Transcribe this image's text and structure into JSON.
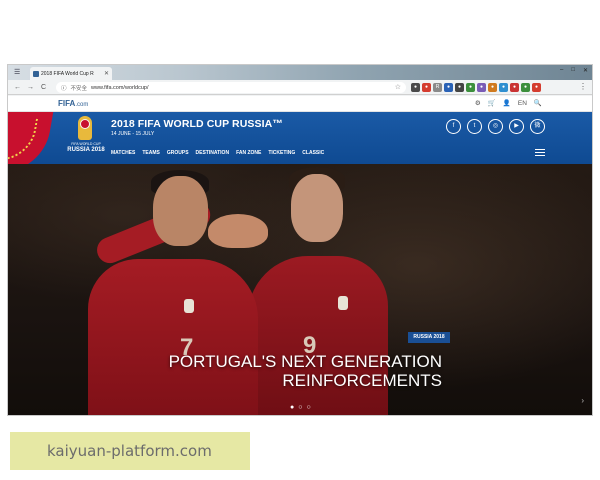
{
  "browser": {
    "tab_title": "2018 FIFA World Cup R",
    "tab_close": "✕",
    "url": "www.fifa.com/worldcup/",
    "security_label": "不安全",
    "nav_back": "←",
    "nav_forward": "→",
    "nav_reload": "C",
    "win_controls": [
      "–",
      "□",
      "✕"
    ],
    "extensions": [
      {
        "icon": "ext-icon-1",
        "color": "#4a4a4a",
        "glyph": "●"
      },
      {
        "icon": "ext-icon-2",
        "color": "#d43c2f",
        "glyph": "●"
      },
      {
        "icon": "ext-icon-3",
        "color": "#8a8a8a",
        "glyph": "R"
      },
      {
        "icon": "ext-icon-4",
        "color": "#2a62b6",
        "glyph": "●"
      },
      {
        "icon": "ext-icon-5",
        "color": "#444444",
        "glyph": "●"
      },
      {
        "icon": "ext-icon-6",
        "color": "#3c8f3c",
        "glyph": "●"
      },
      {
        "icon": "ext-icon-7",
        "color": "#7a5bb6",
        "glyph": "●"
      },
      {
        "icon": "ext-icon-8",
        "color": "#d07a1f",
        "glyph": "●"
      },
      {
        "icon": "ext-icon-9",
        "color": "#2f8fd0",
        "glyph": "●"
      },
      {
        "icon": "ext-icon-10",
        "color": "#c93333",
        "glyph": "●"
      },
      {
        "icon": "ext-icon-11",
        "color": "#3c8f3c",
        "glyph": "●"
      },
      {
        "icon": "ext-icon-12",
        "color": "#d43c2f",
        "glyph": "●"
      }
    ]
  },
  "fifa": {
    "logo": "FIFA",
    "logo_suffix": ".com",
    "top_icons": {
      "settings": "⚙",
      "cart": "🛒",
      "user": "👤",
      "lang": "EN",
      "search": "🔍"
    }
  },
  "worldcup": {
    "emblem_line1": "FIFA WORLD CUP",
    "emblem_line2": "RUSSIA 2018",
    "title": "2018 FIFA WORLD CUP RUSSIA™",
    "dates": "14 JUNE - 15 JULY",
    "nav": [
      "MATCHES",
      "TEAMS",
      "GROUPS",
      "DESTINATION",
      "FAN ZONE",
      "TICKETING",
      "CLASSIC"
    ],
    "socials": [
      {
        "name": "facebook-icon",
        "glyph": "f"
      },
      {
        "name": "twitter-icon",
        "glyph": "t"
      },
      {
        "name": "instagram-icon",
        "glyph": "◎"
      },
      {
        "name": "youtube-icon",
        "glyph": "▶"
      },
      {
        "name": "weibo-icon",
        "glyph": "微"
      }
    ]
  },
  "hero": {
    "tag": "RUSSIA 2018",
    "headline_line1": "PORTUGAL'S NEXT GENERATION",
    "headline_line2": "REINFORCEMENTS",
    "player_number_left": "7",
    "player_number_right": "9",
    "carousel_dots": [
      "●",
      "○",
      "○"
    ],
    "next_arrow": "›"
  },
  "watermark": {
    "text": "kaiyuan-platform.com"
  },
  "colors": {
    "fifa_blue": "#1a5aa6",
    "fifa_red": "#c8102e",
    "portugal_red": "#a51c24"
  }
}
